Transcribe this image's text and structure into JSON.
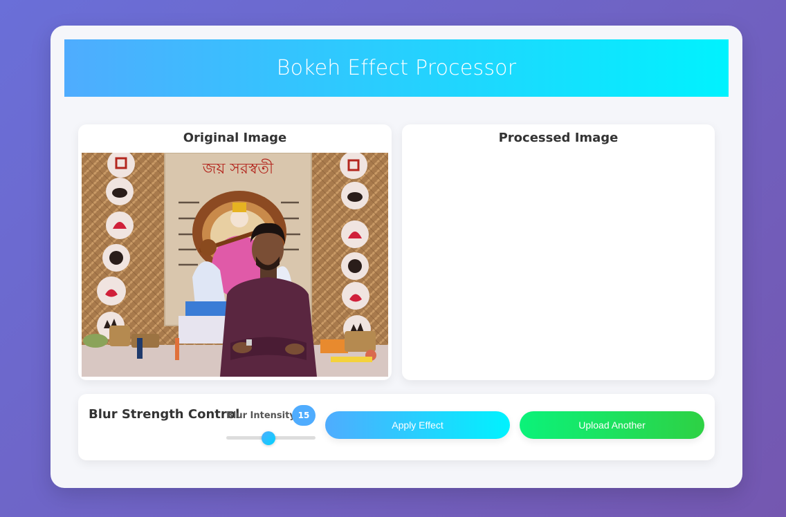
{
  "header": {
    "title": "Bokeh Effect Processor"
  },
  "panels": {
    "original": {
      "title": "Original Image"
    },
    "processed": {
      "title": "Processed Image"
    }
  },
  "photo": {
    "banner_text": "জয় সরস্বতী"
  },
  "controls": {
    "title": "Blur Strength Control",
    "slider_label": "Blur Intensity",
    "slider_value": "15",
    "slider_fraction": 0.47,
    "apply_label": "Apply Effect",
    "upload_label": "Upload Another"
  },
  "colors": {
    "accent_start": "#4facfe",
    "accent_end": "#00f2fe",
    "upload_start": "#0bf27a",
    "upload_end": "#2ed144"
  }
}
